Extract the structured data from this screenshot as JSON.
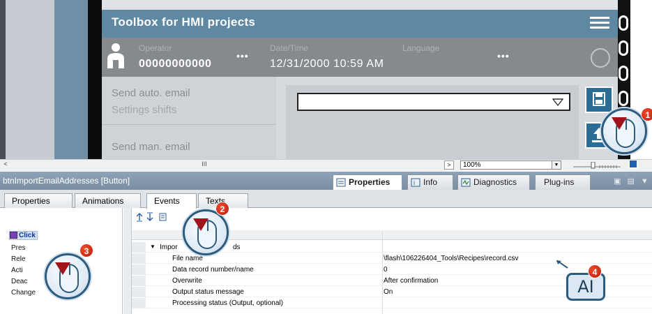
{
  "hmi": {
    "title": "Toolbox for HMI projects",
    "operator_label": "Operator",
    "operator_value": "00000000000",
    "datetime_label": "Date/Time",
    "datetime_value": "12/31/2000 10:59 AM",
    "language_label": "Language",
    "more_dots": "•••",
    "email_items": [
      "Send auto. email",
      "Settings shifts",
      "Send man. email"
    ]
  },
  "editor": {
    "zoom": "100%",
    "scroll_thumb": "III"
  },
  "inspector": {
    "object_title": "btnImportEmailAddresses [Button]",
    "tabs": [
      "Properties",
      "Info",
      "Diagnostics",
      "Plug-ins"
    ],
    "active_tab": "Properties"
  },
  "subtabs": [
    "Properties",
    "Animations",
    "Events",
    "Texts"
  ],
  "events": [
    "Click",
    "Press",
    "Release",
    "Activate",
    "Deactivate",
    "Change"
  ],
  "events_visible_text": [
    "Click",
    "Pres",
    "Rele",
    "Acti",
    "Deac",
    "Change"
  ],
  "function_list": {
    "group_label": "ImportDataRecords",
    "group_visible_text_left": "Impor",
    "group_visible_text_right": "ds",
    "rows": [
      {
        "name": "File name",
        "value": "\\flash\\106226404_Tools\\Recipes\\record.csv"
      },
      {
        "name": "Data record number/name",
        "value": "0"
      },
      {
        "name": "Overwrite",
        "value": "After confirmation"
      },
      {
        "name": "Output status message",
        "value": "On"
      },
      {
        "name": "Processing status (Output, optional)",
        "value": ""
      }
    ]
  },
  "callouts": {
    "badges": [
      "1",
      "2",
      "3",
      "4"
    ],
    "ai_text": "AI"
  },
  "colors": {
    "hmi_title_bg": "#5f88a3",
    "status_bar_bg": "#86898d",
    "hmi_button": "#2c6d95",
    "inspector_bar": "#7a8ea3",
    "badge_red": "#d9321a",
    "selected_event": "#d3e2f4"
  }
}
